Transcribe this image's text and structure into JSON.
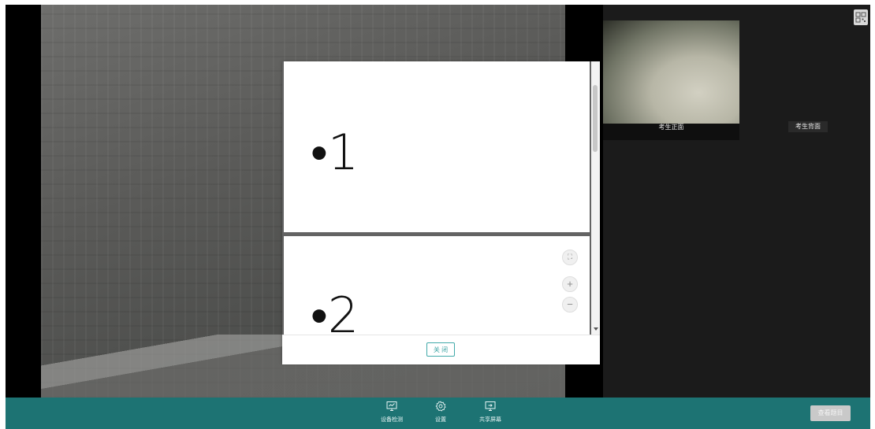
{
  "document": {
    "pages": [
      {
        "text": "•1"
      },
      {
        "text": "•2"
      }
    ],
    "close_label": "关 闭"
  },
  "cameras": {
    "front_label": "考生正面",
    "back_label": "考生背面"
  },
  "toolbar": {
    "items": [
      {
        "label": "设备检测",
        "icon": "monitor-check-icon"
      },
      {
        "label": "设置",
        "icon": "gear-icon"
      },
      {
        "label": "共享屏幕",
        "icon": "share-screen-icon"
      }
    ],
    "view_exam_label": "查看题目"
  },
  "colors": {
    "toolbar_bg": "#1d7373",
    "accent": "#3aa3a3"
  }
}
